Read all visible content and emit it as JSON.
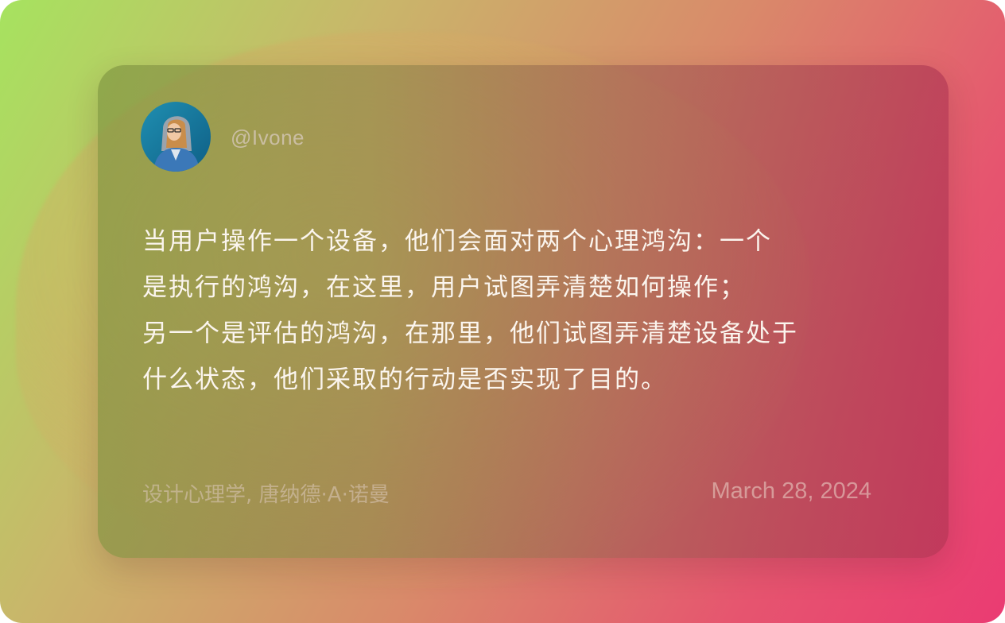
{
  "card": {
    "author_handle": "@Ivone",
    "quote_lines": [
      "当用户操作一个设备，他们会面对两个心理鸿沟：一个",
      "是执行的鸿沟，在这里，用户试图弄清楚如何操作；",
      "另一个是评估的鸿沟，在那里，他们试图弄清楚设备处于",
      "什么状态，他们采取的行动是否实现了目的。"
    ],
    "source": "设计心理学, 唐纳德·A·诺曼",
    "date": "March 28, 2024"
  },
  "colors": {
    "background_start": "#a6e35f",
    "background_end": "#ea3b72",
    "quote_text": "#fbf5ee"
  },
  "icons": {
    "avatar": "user-avatar-photo"
  }
}
